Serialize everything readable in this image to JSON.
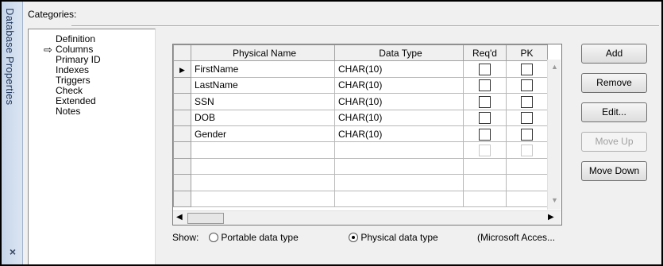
{
  "side_tab": {
    "title": "Database Properties",
    "close_glyph": "×"
  },
  "categories": {
    "label": "Categories:",
    "items": [
      "Definition",
      "Columns",
      "Primary ID",
      "Indexes",
      "Triggers",
      "Check",
      "Extended",
      "Notes"
    ],
    "selected": "Columns"
  },
  "grid": {
    "headers": [
      "Physical Name",
      "Data Type",
      "Req'd",
      "PK"
    ],
    "rows": [
      {
        "name": "FirstName",
        "type": "CHAR(10)",
        "reqd": false,
        "pk": false,
        "current": true
      },
      {
        "name": "LastName",
        "type": "CHAR(10)",
        "reqd": false,
        "pk": false
      },
      {
        "name": "SSN",
        "type": "CHAR(10)",
        "reqd": false,
        "pk": false
      },
      {
        "name": "DOB",
        "type": "CHAR(10)",
        "reqd": false,
        "pk": false
      },
      {
        "name": "Gender",
        "type": "CHAR(10)",
        "reqd": false,
        "pk": false
      }
    ]
  },
  "buttons": {
    "add": "Add",
    "remove": "Remove",
    "edit": "Edit...",
    "move_up": "Move Up",
    "move_down": "Move Down"
  },
  "show": {
    "label": "Show:",
    "portable": "Portable data type",
    "physical": "Physical data type",
    "selected": "physical",
    "target": "(Microsoft Acces..."
  }
}
